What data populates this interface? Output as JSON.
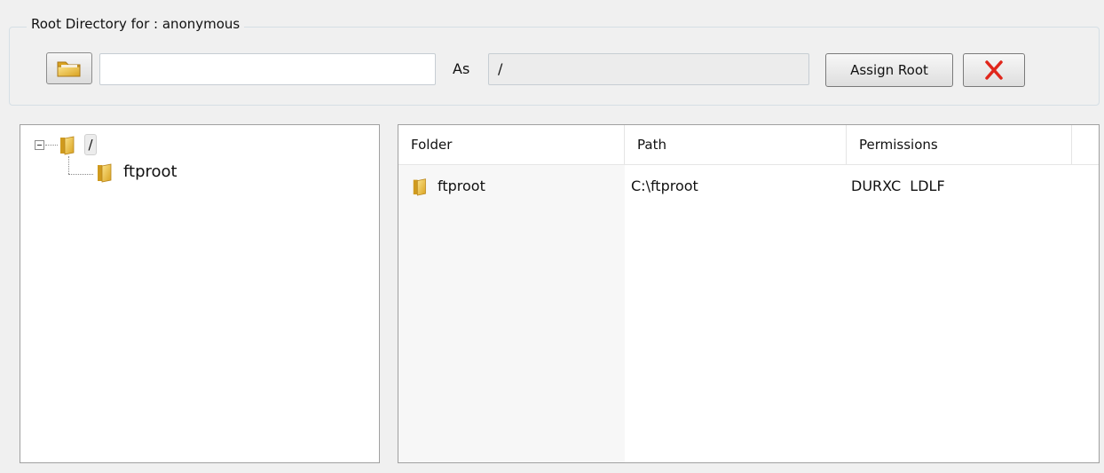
{
  "root_group": {
    "legend": "Root Directory for : anonymous",
    "browse_icon": "folder-open-icon",
    "path_value": "",
    "as_label": "As",
    "alias_value": "/",
    "assign_root_label": "Assign Root",
    "remove_icon": "red-x-icon"
  },
  "tree": {
    "root": {
      "label": "/",
      "icon": "folder-icon",
      "expanded": true
    },
    "children": [
      {
        "label": "ftproot",
        "icon": "folder-icon"
      }
    ]
  },
  "list": {
    "columns": [
      "Folder",
      "Path",
      "Permissions"
    ],
    "rows": [
      {
        "folder": "ftproot",
        "path": "C:\\ftproot",
        "permissions": "DURXC  LDLF",
        "icon": "folder-icon"
      }
    ]
  },
  "colors": {
    "window_bg": "#f0f0f0",
    "folder_yellow": "#e9b62c",
    "remove_red": "#e0261b"
  }
}
